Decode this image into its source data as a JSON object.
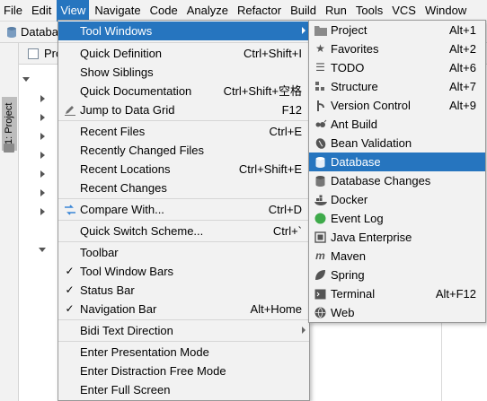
{
  "menubar": [
    "File",
    "Edit",
    "View",
    "Navigate",
    "Code",
    "Analyze",
    "Refactor",
    "Build",
    "Run",
    "Tools",
    "VCS",
    "Window"
  ],
  "navbar": {
    "crumb": "Databa"
  },
  "sidebar": {
    "project_tab": "1: Project"
  },
  "project_panel": {
    "title": "Pro"
  },
  "view_menu": {
    "items": [
      {
        "label": "Tool Windows",
        "shortcut": ""
      },
      {
        "label": "Quick Definition",
        "shortcut": "Ctrl+Shift+I"
      },
      {
        "label": "Show Siblings",
        "shortcut": ""
      },
      {
        "label": "Quick Documentation",
        "shortcut": "Ctrl+Shift+空格"
      },
      {
        "label": "Jump to Data Grid",
        "shortcut": "F12"
      },
      {
        "label": "Recent Files",
        "shortcut": "Ctrl+E"
      },
      {
        "label": "Recently Changed Files",
        "shortcut": ""
      },
      {
        "label": "Recent Locations",
        "shortcut": "Ctrl+Shift+E"
      },
      {
        "label": "Recent Changes",
        "shortcut": ""
      },
      {
        "label": "Compare With...",
        "shortcut": "Ctrl+D"
      },
      {
        "label": "Quick Switch Scheme...",
        "shortcut": "Ctrl+`"
      },
      {
        "label": "Toolbar",
        "shortcut": ""
      },
      {
        "label": "Tool Window Bars",
        "shortcut": ""
      },
      {
        "label": "Status Bar",
        "shortcut": ""
      },
      {
        "label": "Navigation Bar",
        "shortcut": "Alt+Home"
      },
      {
        "label": "Bidi Text Direction",
        "shortcut": ""
      },
      {
        "label": "Enter Presentation Mode",
        "shortcut": ""
      },
      {
        "label": "Enter Distraction Free Mode",
        "shortcut": ""
      },
      {
        "label": "Enter Full Screen",
        "shortcut": ""
      }
    ]
  },
  "tool_windows_menu": {
    "items": [
      {
        "label": "Project",
        "shortcut": "Alt+1",
        "icon": "folder-icon"
      },
      {
        "label": "Favorites",
        "shortcut": "Alt+2",
        "icon": "star-icon"
      },
      {
        "label": "TODO",
        "shortcut": "Alt+6",
        "icon": "list-icon"
      },
      {
        "label": "Structure",
        "shortcut": "Alt+7",
        "icon": "structure-icon"
      },
      {
        "label": "Version Control",
        "shortcut": "Alt+9",
        "icon": "version-control-icon"
      },
      {
        "label": "Ant Build",
        "shortcut": "",
        "icon": "ant-icon"
      },
      {
        "label": "Bean Validation",
        "shortcut": "",
        "icon": "bean-icon"
      },
      {
        "label": "Database",
        "shortcut": "",
        "icon": "database-icon"
      },
      {
        "label": "Database Changes",
        "shortcut": "",
        "icon": "database-changes-icon"
      },
      {
        "label": "Docker",
        "shortcut": "",
        "icon": "docker-icon"
      },
      {
        "label": "Event Log",
        "shortcut": "",
        "icon": "event-log-icon"
      },
      {
        "label": "Java Enterprise",
        "shortcut": "",
        "icon": "java-enterprise-icon"
      },
      {
        "label": "Maven",
        "shortcut": "",
        "icon": "maven-icon"
      },
      {
        "label": "Spring",
        "shortcut": "",
        "icon": "spring-icon"
      },
      {
        "label": "Terminal",
        "shortcut": "Alt+F12",
        "icon": "terminal-icon"
      },
      {
        "label": "Web",
        "shortcut": "",
        "icon": "web-icon"
      }
    ]
  },
  "colors": {
    "selection": "#2675bf",
    "menu_bg": "#f2f2f2",
    "event_log_green": "#3eaa4a",
    "compare_blue": "#3a86d6"
  }
}
